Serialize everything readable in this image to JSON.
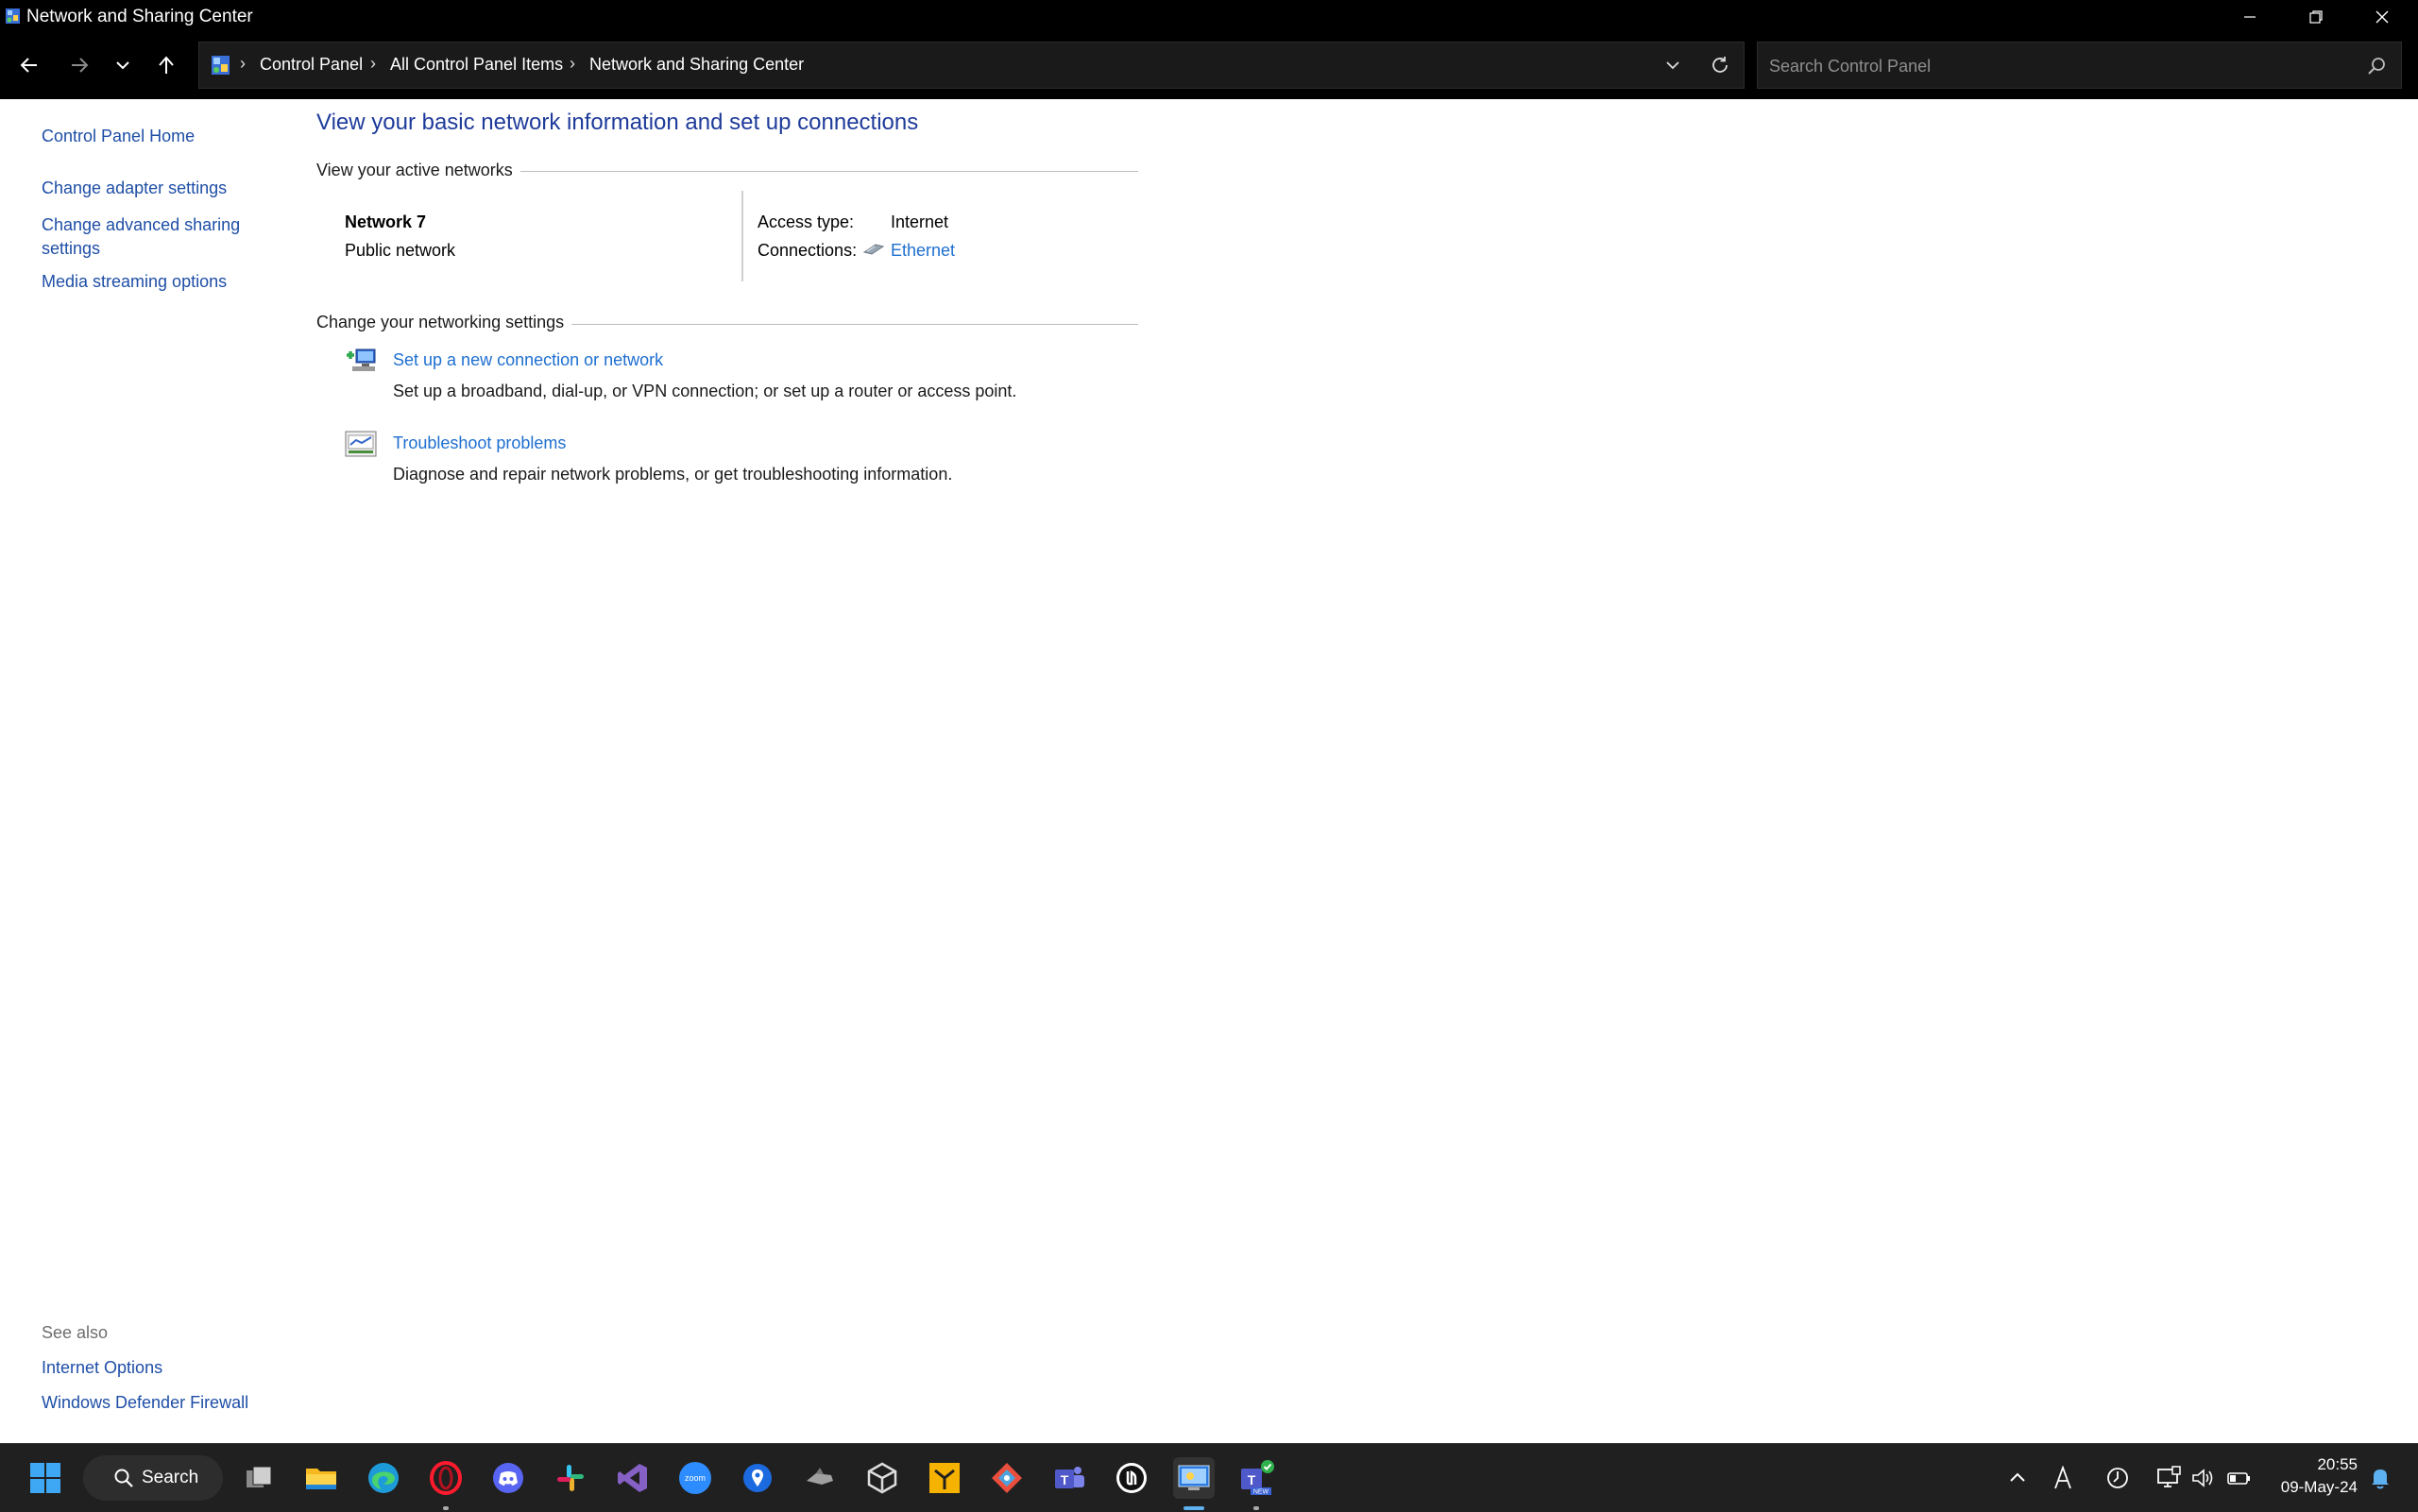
{
  "window": {
    "title": "Network and Sharing Center"
  },
  "address_bar": {
    "crumbs": [
      "Control Panel",
      "All Control Panel Items",
      "Network and Sharing Center"
    ],
    "separator": "›"
  },
  "search": {
    "placeholder": "Search Control Panel"
  },
  "sidebar": {
    "home": "Control Panel Home",
    "items": [
      "Change adapter settings",
      "Change advanced sharing settings",
      "Media streaming options"
    ],
    "see_also_label": "See also",
    "see_also": [
      "Internet Options",
      "Windows Defender Firewall"
    ]
  },
  "main": {
    "heading": "View your basic network information and set up connections",
    "active_networks_label": "View your active networks",
    "network": {
      "name": "Network 7",
      "type": "Public network",
      "access_type_label": "Access type:",
      "access_type_value": "Internet",
      "connections_label": "Connections:",
      "connections_value": "Ethernet"
    },
    "change_settings_label": "Change your networking settings",
    "tasks": [
      {
        "link": "Set up a new connection or network",
        "description": "Set up a broadband, dial-up, or VPN connection; or set up a router or access point."
      },
      {
        "link": "Troubleshoot problems",
        "description": "Diagnose and repair network problems, or get troubleshooting information."
      }
    ]
  },
  "taskbar": {
    "search_label": "Search",
    "apps": [
      "start",
      "search",
      "task-view",
      "file-explorer",
      "edge",
      "opera",
      "discord",
      "slack",
      "visual-studio",
      "zoom",
      "maps",
      "game",
      "unity",
      "git-extensions",
      "sourcetree",
      "teams",
      "unreal",
      "control-panel",
      "teams-new"
    ],
    "time": "20:55",
    "date": "09-May-24"
  },
  "colors": {
    "chrome": "#000000",
    "link": "#1e6fd0",
    "heading": "#1e3b9a",
    "taskbar": "#202020"
  }
}
